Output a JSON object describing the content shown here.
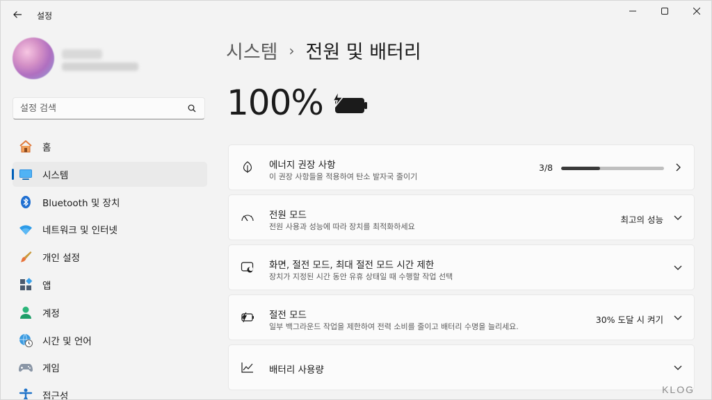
{
  "titlebar": {
    "app_title": "설정"
  },
  "sidebar": {
    "search": {
      "placeholder": "설정 검색"
    },
    "items": [
      {
        "label": "홈",
        "icon": "home-icon"
      },
      {
        "label": "시스템",
        "icon": "system-icon",
        "selected": true
      },
      {
        "label": "Bluetooth 및 장치",
        "icon": "bluetooth-icon"
      },
      {
        "label": "네트워크 및 인터넷",
        "icon": "wifi-icon"
      },
      {
        "label": "개인 설정",
        "icon": "brush-icon"
      },
      {
        "label": "앱",
        "icon": "apps-icon"
      },
      {
        "label": "계정",
        "icon": "account-icon"
      },
      {
        "label": "시간 및 언어",
        "icon": "globe-clock-icon"
      },
      {
        "label": "게임",
        "icon": "gamepad-icon"
      },
      {
        "label": "접근성",
        "icon": "accessibility-icon"
      }
    ]
  },
  "main": {
    "breadcrumb": {
      "parent": "시스템",
      "separator": "›",
      "current": "전원 및 배터리"
    },
    "battery": {
      "percent": "100%",
      "charging": true
    },
    "cards": [
      {
        "title": "에너지 권장 사항",
        "desc": "이 권장 사항들을 적용하여 탄소 발자국 줄이기",
        "progress_text": "3/8",
        "progress": 0.375,
        "icon": "leaf-icon"
      },
      {
        "title": "전원 모드",
        "desc": "전원 사용과 성능에 따라 장치를 최적화하세요",
        "value": "최고의 성능",
        "icon": "speedometer-icon"
      },
      {
        "title": "화면, 절전 모드, 최대 절전 모드 시간 제한",
        "desc": "장치가 지정된 시간 동안 유휴 상태일 때 수행할 작업 선택",
        "icon": "screen-sleep-icon"
      },
      {
        "title": "절전 모드",
        "desc": "일부 백그라운드 작업을 제한하여 전력 소비를 줄이고 배터리 수명을 늘리세요.",
        "value": "30% 도달 시 켜기",
        "icon": "battery-saver-icon"
      },
      {
        "title": "배터리 사용량",
        "icon": "chart-line-icon"
      }
    ]
  },
  "watermark": "KLOG"
}
